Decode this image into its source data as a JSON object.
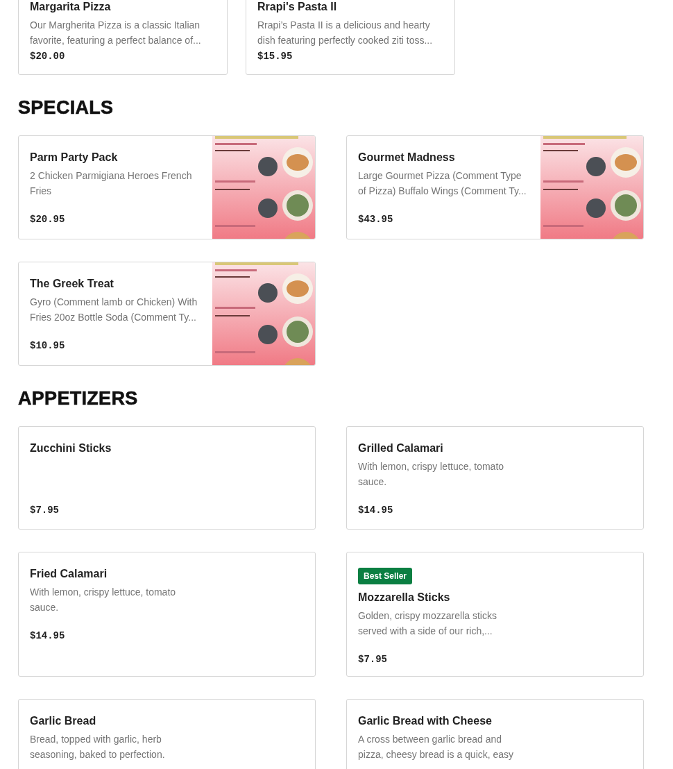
{
  "sections": [
    {
      "items": [
        {
          "name": "Margarita Pizza",
          "description": "Our Margherita Pizza is a classic Italian favorite, featuring a perfect balance of...",
          "price": "$20.00"
        },
        {
          "name": "Rrapi's Pasta II",
          "description": "Rrapi’s Pasta II is a delicious and hearty dish featuring perfectly cooked ziti toss...",
          "price": "$15.95"
        }
      ]
    },
    {
      "title": "SPECIALS",
      "items": [
        {
          "name": "Parm Party Pack",
          "description": "2 Chicken Parmigiana Heroes French Fries",
          "price": "$20.95"
        },
        {
          "name": "Gourmet Madness",
          "description": "Large Gourmet Pizza (Comment Type of Pizza) Buffalo Wings (Comment Ty...",
          "price": "$43.95"
        },
        {
          "name": "The Greek Treat",
          "description": "Gyro (Comment lamb or Chicken) With Fries 20oz Bottle Soda (Comment Ty...",
          "price": "$10.95"
        }
      ]
    },
    {
      "title": "APPETIZERS",
      "items": [
        {
          "name": "Zucchini Sticks",
          "price": "$7.95"
        },
        {
          "name": "Grilled Calamari",
          "description": "With lemon, crispy lettuce, tomato sauce.",
          "price": "$14.95"
        },
        {
          "name": "Fried Calamari",
          "description": "With lemon, crispy lettuce, tomato sauce.",
          "price": "$14.95"
        },
        {
          "badge": "Best Seller",
          "name": "Mozzarella Sticks",
          "description": "Golden, crispy mozzarella sticks served with a side of our rich,...",
          "price": "$7.95"
        },
        {
          "name": "Garlic Bread",
          "description": "Bread, topped with garlic, herb seasoning, baked to perfection."
        },
        {
          "name": "Garlic Bread with Cheese",
          "description": "A cross between garlic bread and pizza, cheesy bread is a quick, easy"
        }
      ]
    }
  ]
}
